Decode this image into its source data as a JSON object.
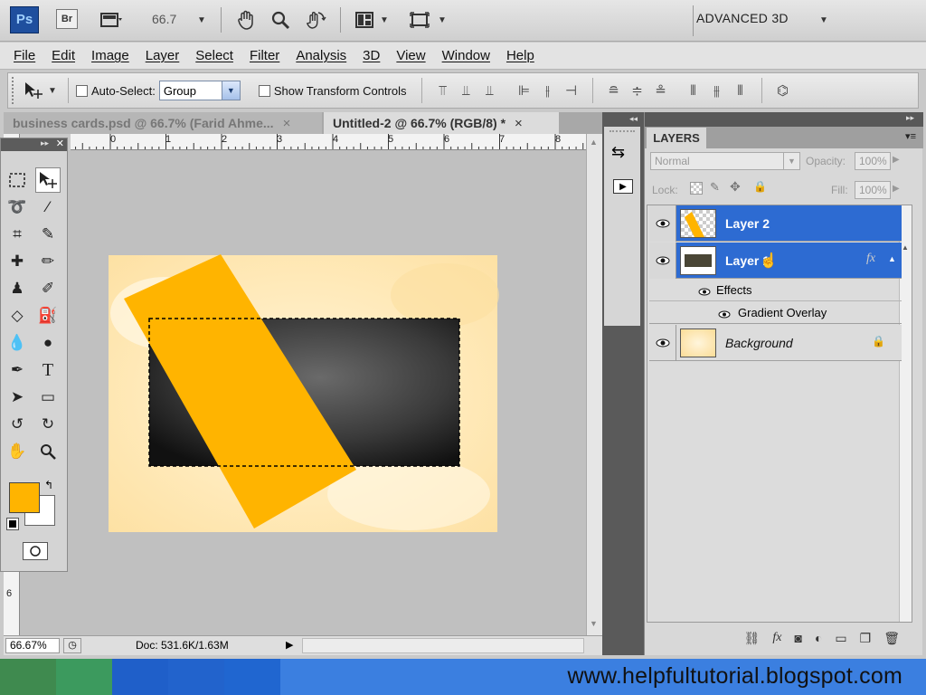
{
  "appbar": {
    "logo": "Ps",
    "bridge": "Br",
    "zoom": "66.7",
    "workspace": "ADVANCED 3D",
    "icons": [
      "screen-mode-icon",
      "hand-icon",
      "zoom-icon",
      "rotate-view-icon",
      "arrange-icon",
      "screen-mode-toggle-icon"
    ]
  },
  "menu": [
    "File",
    "Edit",
    "Image",
    "Layer",
    "Select",
    "Filter",
    "Analysis",
    "3D",
    "View",
    "Window",
    "Help"
  ],
  "options": {
    "auto_select_label": "Auto-Select:",
    "auto_select_value": "Group",
    "show_transform_label": "Show Transform Controls"
  },
  "tabs": [
    {
      "label": "business cards.psd @ 66.7% (Farid Ahme...",
      "close": "×",
      "active": false
    },
    {
      "label": "Untitled-2 @ 66.7% (RGB/8) *",
      "close": "×",
      "active": true
    }
  ],
  "ruler": {
    "h": [
      "0",
      "1",
      "2",
      "3",
      "4",
      "5",
      "6",
      "7",
      "8"
    ],
    "v": [
      "6"
    ]
  },
  "status": {
    "zoom": "66.67%",
    "doc": "Doc: 531.6K/1.63M"
  },
  "colors": {
    "foreground": "#ffb400",
    "background": "#ffffff",
    "selection_blue": "#2d6bd2"
  },
  "layers_panel": {
    "tab": "LAYERS",
    "blend_mode": "Normal",
    "opacity_label": "Opacity:",
    "opacity_value": "100%",
    "lock_label": "Lock:",
    "fill_label": "Fill:",
    "fill_value": "100%",
    "layers": [
      {
        "name": "Layer 2",
        "selected": true
      },
      {
        "name": "Layer 1",
        "selected": true,
        "fx": "fx"
      },
      {
        "name": "Background",
        "selected": false,
        "locked": true
      }
    ],
    "effects_label": "Effects",
    "gradient_overlay_label": "Gradient Overlay"
  },
  "watermark": "www.helpfultutorial.blogspot.com"
}
